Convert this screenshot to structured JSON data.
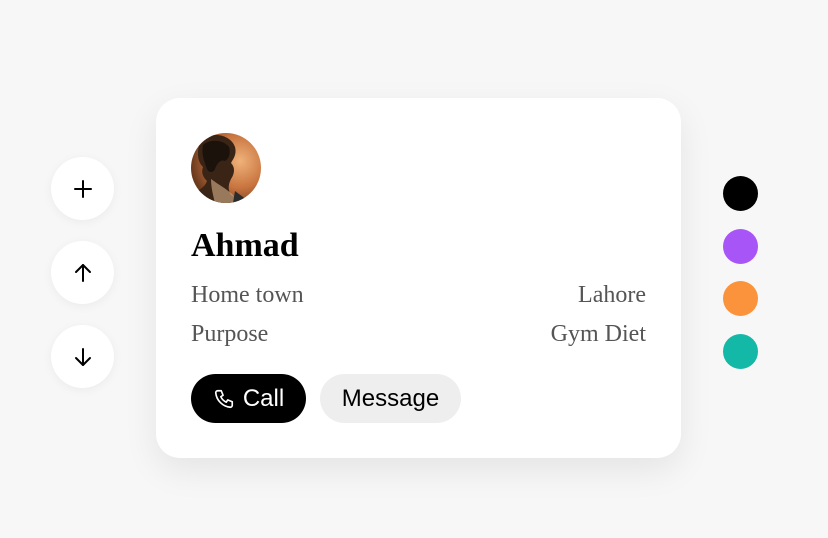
{
  "profile": {
    "name": "Ahmad",
    "details": [
      {
        "label": "Home town",
        "value": "Lahore"
      },
      {
        "label": "Purpose",
        "value": "Gym Diet"
      }
    ]
  },
  "actions": {
    "call_label": "Call",
    "message_label": "Message"
  },
  "side_controls": {
    "icons": [
      "plus-icon",
      "arrow-up-icon",
      "arrow-down-icon"
    ]
  },
  "theme": {
    "swatches": [
      "#000000",
      "#a855f7",
      "#fb923c",
      "#14b8a6"
    ],
    "card_background": "#ffffff",
    "page_background": "#f7f7f7"
  }
}
